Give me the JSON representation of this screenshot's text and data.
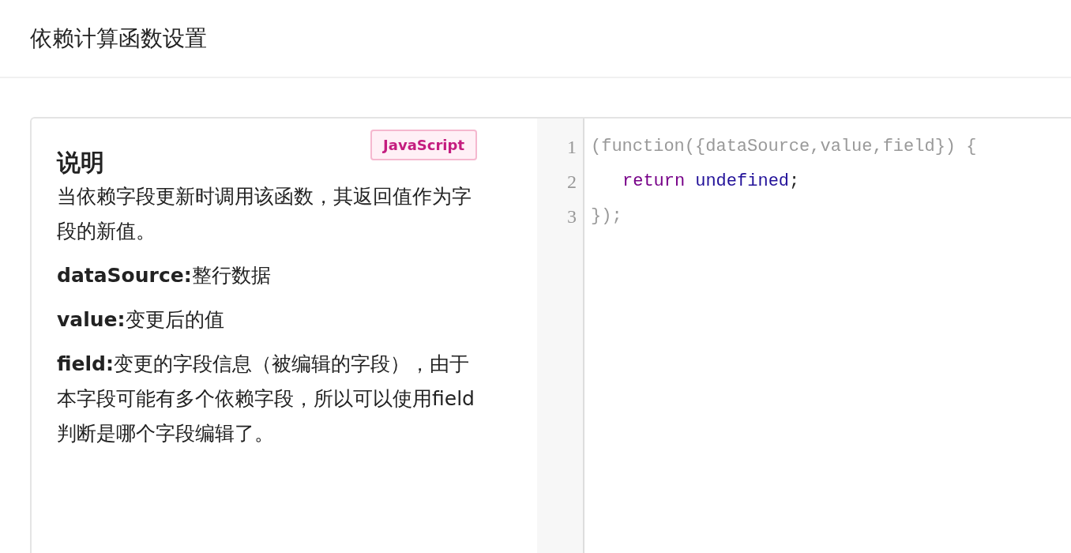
{
  "header": {
    "title": "依赖计算函数设置"
  },
  "description": {
    "heading": "说明",
    "language_tag": "JavaScript",
    "paragraphs": [
      "当依赖字段更新时调用该函数，其返回值作为字段的新值。",
      "**dataSource:**整行数据",
      "**value:**变更后的值",
      "**field:**变更的字段信息（被编辑的字段），由于本字段可能有多个依赖字段，所以可以使用field判断是哪个字段编辑了。"
    ]
  },
  "editor": {
    "lines": [
      {
        "number": "1",
        "indented": false,
        "tokens": [
          {
            "kind": "muted",
            "text": "(function({dataSource,value,field}) {"
          }
        ]
      },
      {
        "number": "2",
        "indented": true,
        "tokens": [
          {
            "kind": "keyword",
            "text": "return"
          },
          {
            "kind": "atom",
            "text": "undefined"
          },
          {
            "kind": "plain",
            "text": ";"
          }
        ]
      },
      {
        "number": "3",
        "indented": false,
        "tokens": [
          {
            "kind": "muted",
            "text": "});"
          }
        ]
      }
    ]
  }
}
